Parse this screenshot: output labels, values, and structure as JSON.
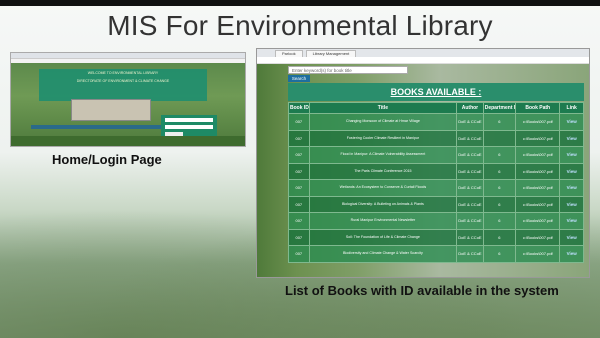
{
  "slide": {
    "title": "MIS For Environmental Library",
    "left_caption": "Home/Login Page",
    "right_caption": "List of Books with ID available in the system"
  },
  "login_page": {
    "banner_line1": "WELCOME TO ENVIRONMENTAL LIBRARY",
    "banner_line2": "DIRECTORATE OF ENVIRONMENT & CLIMATE CHANGE"
  },
  "books_page": {
    "tabs": [
      "Parlook",
      "Library Management"
    ],
    "search_placeholder": "Enter keyword(s) for book title",
    "search_button": "Search",
    "heading": "BOOKS AVAILABLE :",
    "columns": [
      "Book ID",
      "Title",
      "Author",
      "Department ID",
      "Book Path",
      "Link"
    ],
    "rows": [
      {
        "id": "007",
        "title": "Changing Monsoon of Climate at Hmar Village",
        "author": "DoE & CCoE",
        "dept": "6",
        "path": "c:\\Books\\007.pdf",
        "link": "View"
      },
      {
        "id": "007",
        "title": "Fostering Cooler Climate Resilient in Manipur",
        "author": "DoE & CCoE",
        "dept": "",
        "path": "c:\\Books\\007.pdf",
        "link": "View"
      },
      {
        "id": "007",
        "title": "Flood in Manipur: A Climate Vulnerability Assessment",
        "author": "DoE & CCoE",
        "dept": "6",
        "path": "c:\\Books\\007.pdf",
        "link": "View"
      },
      {
        "id": "007",
        "title": "The Paris Climate Conference 2015",
        "author": "DoE & CCoE",
        "dept": "6",
        "path": "c:\\Books\\007.pdf",
        "link": "View"
      },
      {
        "id": "007",
        "title": "Wetlands: An Ecosystem to Conserve & Curtail Floods",
        "author": "DoE & CCoE",
        "dept": "6",
        "path": "c:\\Books\\007.pdf",
        "link": "View"
      },
      {
        "id": "007",
        "title": "Biological Diversity: A Bulleting on Animals & Plants",
        "author": "DoE & CCoE",
        "dept": "6",
        "path": "c:\\Books\\007.pdf",
        "link": "View"
      },
      {
        "id": "007",
        "title": "Rural Manipur Environmental Newsletter",
        "author": "DoE & CCoE",
        "dept": "6",
        "path": "c:\\Books\\007.pdf",
        "link": "View"
      },
      {
        "id": "007",
        "title": "Soil: The Foundation of Life & Climate Change",
        "author": "DoE & CCoE",
        "dept": "6",
        "path": "c:\\Books\\007.pdf",
        "link": "View"
      },
      {
        "id": "007",
        "title": "Biodiversity and Climate Change & Water Scarcity",
        "author": "DoE & CCoE",
        "dept": "6",
        "path": "c:\\Books\\007.pdf",
        "link": "View"
      }
    ]
  }
}
